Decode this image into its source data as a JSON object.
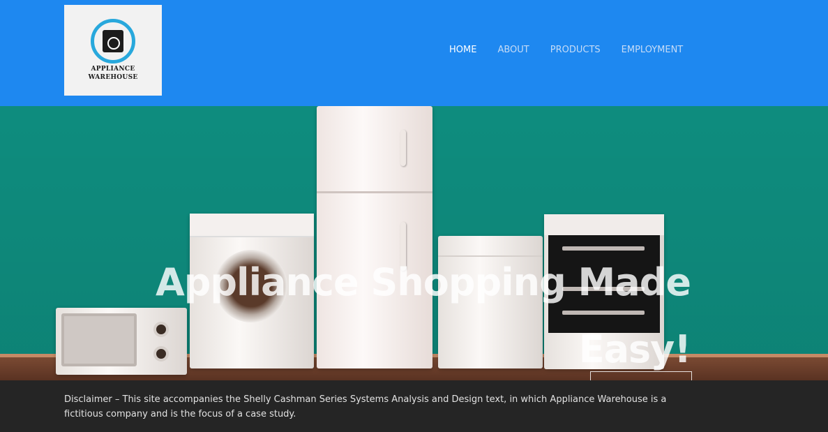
{
  "logo": {
    "line1": "APPLIANCE",
    "line2": "WAREHOUSE"
  },
  "nav": {
    "items": [
      {
        "label": "HOME",
        "active": true
      },
      {
        "label": "ABOUT",
        "active": false
      },
      {
        "label": "PRODUCTS",
        "active": false
      },
      {
        "label": "EMPLOYMENT",
        "active": false
      }
    ]
  },
  "hero": {
    "title_line1": "Appliance Shopping Made",
    "title_line2": "Easy!"
  },
  "footer": {
    "disclaimer": "Disclaimer – This site accompanies the Shelly Cashman Series Systems Analysis and Design text, in which Appliance Warehouse is a fictitious company and is the focus of a case study."
  },
  "colors": {
    "header_bg": "#1e88f0",
    "hero_wall": "#0f9485",
    "footer_bg": "#252525",
    "nav_active": "#ffffff",
    "nav_inactive": "#c6dcf7"
  }
}
